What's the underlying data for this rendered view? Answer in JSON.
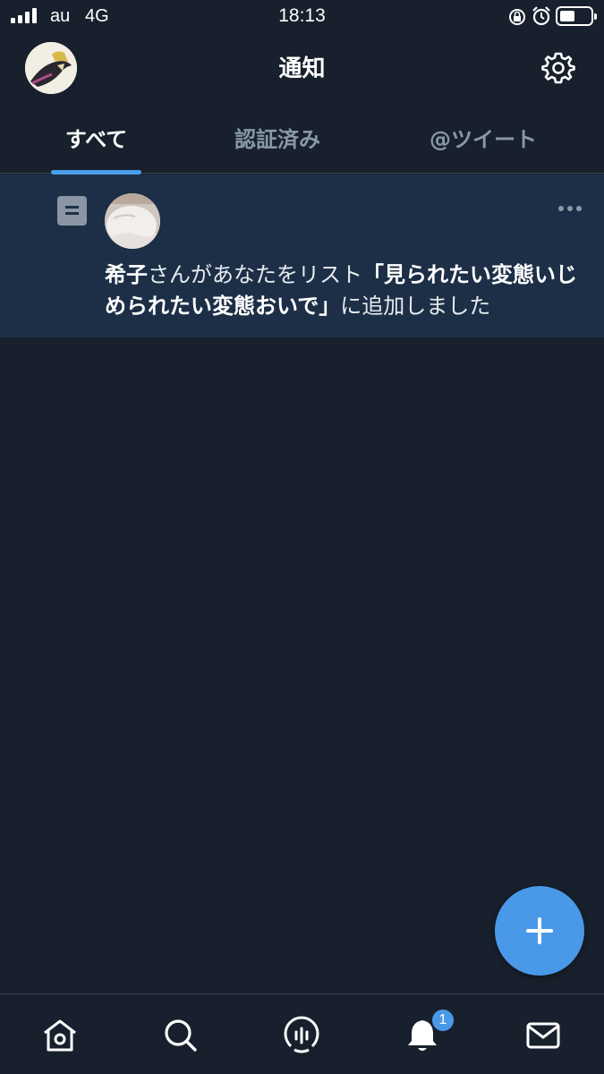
{
  "status_bar": {
    "carrier": "au",
    "network": "4G",
    "time": "18:13"
  },
  "header": {
    "title": "通知"
  },
  "tabs": [
    {
      "label": "すべて",
      "active": true
    },
    {
      "label": "認証済み",
      "active": false
    },
    {
      "label": "@ツイート",
      "active": false
    }
  ],
  "notification": {
    "user": "希子",
    "text_mid": "さんがあなたをリスト",
    "list_name": "「見られたい変態いじめられたい変態おいで」",
    "text_end": "に追加しました"
  },
  "bottom_nav": {
    "badge_count": "1"
  },
  "colors": {
    "background": "#17202c",
    "accent": "#4a99e9",
    "highlight": "#1c2f46"
  }
}
